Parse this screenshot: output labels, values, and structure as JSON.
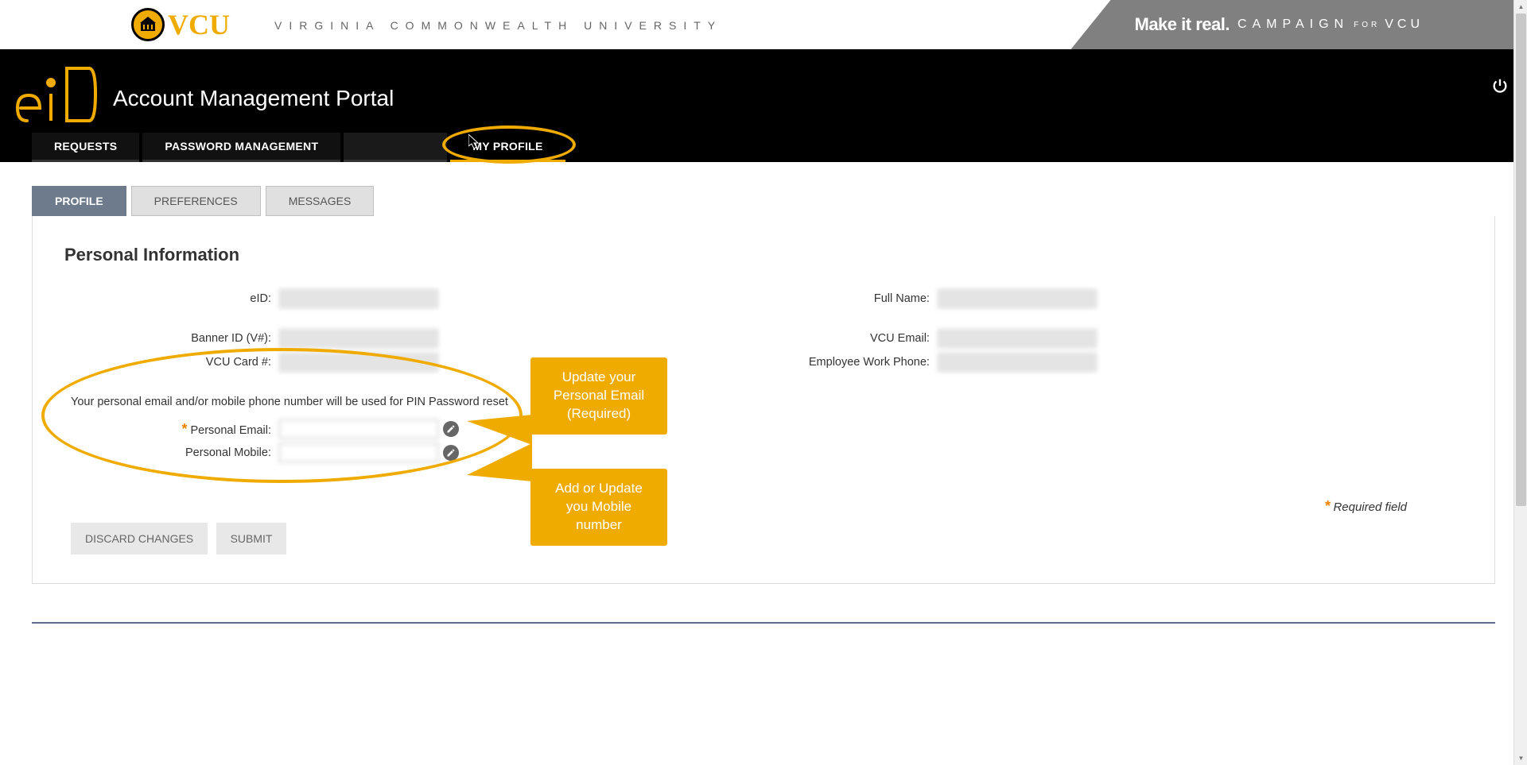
{
  "topbar": {
    "wordmark": "VCU",
    "univ_text": "VIRGINIA COMMONWEALTH UNIVERSITY",
    "campaign_strong": "Make it real.",
    "campaign_word": "CAMPAIGN",
    "campaign_for": "FOR",
    "campaign_vcu": "VCU"
  },
  "header": {
    "portal_title": "Account Management Portal",
    "logout_icon": "power-icon"
  },
  "nav": {
    "tabs": {
      "requests": "REQUESTS",
      "password": "PASSWORD MANAGEMENT",
      "myprofile": "MY PROFILE"
    }
  },
  "subtabs": {
    "profile": "PROFILE",
    "preferences": "PREFERENCES",
    "messages": "MESSAGES"
  },
  "section": {
    "title": "Personal Information",
    "helper": "Your personal email and/or mobile phone number will be used for PIN Password reset",
    "required_note": "Required field"
  },
  "labels": {
    "eid": "eID:",
    "banner": "Banner ID (V#):",
    "vcucard": "VCU Card #:",
    "fullname": "Full Name:",
    "vcuemail": "VCU Email:",
    "workphone": "Employee Work Phone:",
    "personalemail": "Personal Email:",
    "personalmobile": "Personal Mobile:"
  },
  "buttons": {
    "discard": "DISCARD CHANGES",
    "submit": "SUBMIT"
  },
  "callouts": {
    "email": "Update your Personal Email (Required)",
    "mobile": "Add or Update you Mobile number"
  },
  "icons": {
    "edit": "pencil-icon",
    "seal": "building-icon"
  }
}
